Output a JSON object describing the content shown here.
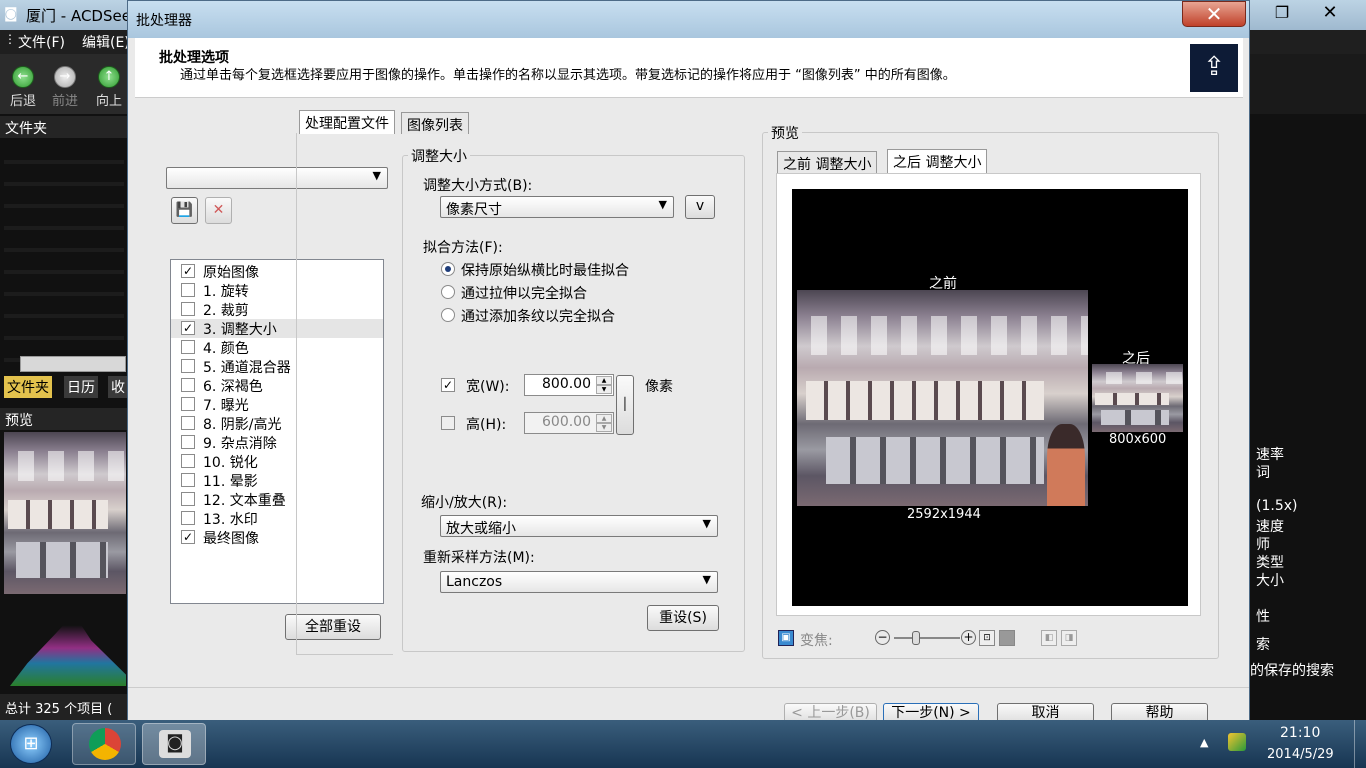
{
  "background_app": {
    "title": "厦门 - ACDSee",
    "menu": [
      "文件(F)",
      "编辑(E)"
    ],
    "nav": {
      "back": "后退",
      "forward": "前进",
      "up": "向上"
    },
    "folders_panel": "文件夹",
    "folder_tabs": [
      "文件夹",
      "日历",
      "收"
    ],
    "preview_panel": "预览",
    "status": "总计 325 个项目 (",
    "right_panel_items": [
      "速率",
      "词",
      "(1.5x)",
      "速度",
      "师",
      "类型",
      "大小",
      "性",
      "索",
      "的保存的搜索"
    ]
  },
  "dialog": {
    "title": "批处理器",
    "close_glyph": "✕",
    "header": {
      "title": "批处理选项",
      "description": "通过单击每个复选框选择要应用于图像的操作。单击操作的名称以显示其选项。带复选标记的操作将应用于 “图像列表” 中的所有图像。"
    },
    "tabs": [
      "处理配置文件",
      "图像列表"
    ],
    "operations": [
      {
        "label": "原始图像",
        "checked": true
      },
      {
        "label": "1.  旋转",
        "checked": false
      },
      {
        "label": "2.  裁剪",
        "checked": false
      },
      {
        "label": "3.  调整大小",
        "checked": true
      },
      {
        "label": "4.  颜色",
        "checked": false
      },
      {
        "label": "5.  通道混合器",
        "checked": false
      },
      {
        "label": "6.  深褐色",
        "checked": false
      },
      {
        "label": "7.  曝光",
        "checked": false
      },
      {
        "label": "8.  阴影/高光",
        "checked": false
      },
      {
        "label": "9.  杂点消除",
        "checked": false
      },
      {
        "label": "10.  锐化",
        "checked": false
      },
      {
        "label": "11.  晕影",
        "checked": false
      },
      {
        "label": "12.  文本重叠",
        "checked": false
      },
      {
        "label": "13.  水印",
        "checked": false
      },
      {
        "label": "最终图像",
        "checked": true
      }
    ],
    "reset_all_label": "全部重设",
    "resize": {
      "group_label": "调整大小",
      "method_label": "调整大小方式(B):",
      "method_value": "像素尺寸",
      "v_button": "v",
      "fit_label": "拟合方法(F):",
      "fit_options": [
        "保持原始纵横比时最佳拟合",
        "通过拉伸以完全拟合",
        "通过添加条纹以完全拟合"
      ],
      "width_label": "宽(W):",
      "width_value": "800.00",
      "height_label": "高(H):",
      "height_value": "600.00",
      "unit": "像素",
      "scale_label": "缩小/放大(R):",
      "scale_value": "放大或缩小",
      "resample_label": "重新采样方法(M):",
      "resample_value": "Lanczos",
      "reset_label": "重设(S)"
    },
    "preview": {
      "group_label": "预览",
      "tabs": [
        "之前 调整大小",
        "之后 调整大小"
      ],
      "before_label": "之前",
      "after_label": "之后",
      "before_size": "2592x1944",
      "after_size": "800x600",
      "zoom_label": "变焦:"
    },
    "footer": {
      "prev": "< 上一步(B)",
      "next": "下一步(N) >",
      "cancel": "取消",
      "help": "帮助"
    }
  },
  "taskbar": {
    "time": "21:10",
    "date": "2014/5/29"
  }
}
